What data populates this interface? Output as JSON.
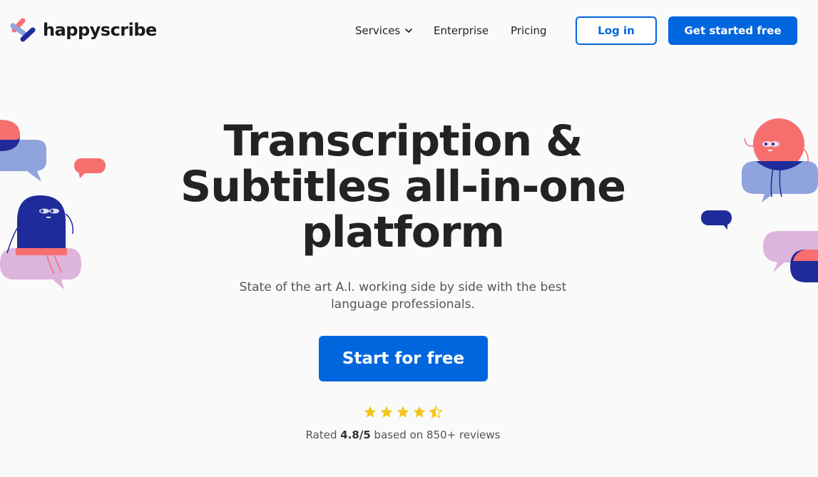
{
  "header": {
    "logo_text": "happyscribe",
    "nav": [
      {
        "label": "Services",
        "has_dropdown": true
      },
      {
        "label": "Enterprise",
        "has_dropdown": false
      },
      {
        "label": "Pricing",
        "has_dropdown": false
      }
    ],
    "login_label": "Log in",
    "get_started_label": "Get started free"
  },
  "hero": {
    "title_line1": "Transcription &",
    "title_line2": "Subtitles all-in-one",
    "title_line3": "platform",
    "subtitle_line1": "State of the art A.I. working side by side with the best",
    "subtitle_line2": "language professionals.",
    "cta_label": "Start for free",
    "rating": {
      "stars": 4.5,
      "prefix": "Rated",
      "score": "4.8/5",
      "suffix": "based on 850+ reviews"
    }
  },
  "colors": {
    "primary": "#0066dd",
    "star": "#f5c518",
    "coral": "#f66f6f",
    "navy": "#1f2b9a",
    "periwinkle": "#8fa3dc",
    "lavender": "#ddb4dc"
  },
  "icons": {
    "logo": "happyscribe-logo-icon",
    "services_dropdown": "chevron-down-icon",
    "star": "star-icon",
    "half_star": "half-star-icon"
  }
}
